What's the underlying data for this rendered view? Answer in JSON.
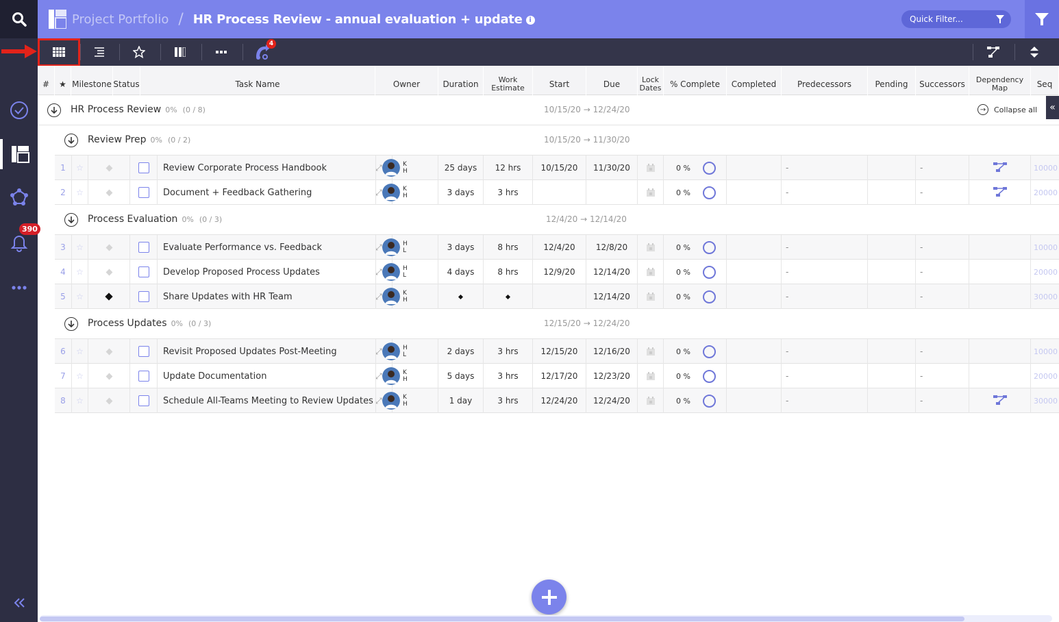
{
  "header": {
    "portfolio": "Project Portfolio",
    "separator": "/",
    "title": "HR Process Review  -  annual evaluation + update",
    "quick_filter_placeholder": "Quick Filter..."
  },
  "rail": {
    "notification_count": "390"
  },
  "toolbar": {
    "automation_badge": "4"
  },
  "columns": {
    "num": "#",
    "star": "★",
    "milestone": "Milestone",
    "status": "Status",
    "task_name": "Task Name",
    "owner": "Owner",
    "duration": "Duration",
    "work_estimate": "Work Estimate",
    "start": "Start",
    "due": "Due",
    "lock_dates": "Lock Dates",
    "pct_complete": "% Complete",
    "completed": "Completed",
    "predecessors": "Predecessors",
    "pending": "Pending",
    "successors": "Successors",
    "dependency_map": "Dependency Map",
    "seq": "Seq"
  },
  "project": {
    "name": "HR Process Review",
    "pct": "0%",
    "count": "(0 / 8)",
    "start": "10/15/20",
    "due": "12/24/20",
    "arrow": "→",
    "collapse_all": "Collapse all"
  },
  "groups": [
    {
      "name": "Review Prep",
      "pct": "0%",
      "count": "(0 / 2)",
      "start": "10/15/20",
      "due": "11/30/20"
    },
    {
      "name": "Process Evaluation",
      "pct": "0%",
      "count": "(0 / 3)",
      "start": "12/4/20",
      "due": "12/14/20"
    },
    {
      "name": "Process Updates",
      "pct": "0%",
      "count": "(0 / 3)",
      "start": "12/15/20",
      "due": "12/24/20"
    }
  ],
  "tasks": [
    {
      "num": "1",
      "name": "Review Corporate Process Handbook",
      "owner_i1": "K",
      "owner_i2": "H",
      "duration": "25 days",
      "work": "12 hrs",
      "start": "10/15/20",
      "due": "11/30/20",
      "pct": "0 %",
      "pred": "-",
      "succ": "-",
      "seq": "10000"
    },
    {
      "num": "2",
      "name": "Document + Feedback Gathering",
      "owner_i1": "K",
      "owner_i2": "H",
      "duration": "3 days",
      "work": "3 hrs",
      "start": "",
      "due": "",
      "pct": "0 %",
      "pred": "-",
      "succ": "-",
      "seq": "20000"
    },
    {
      "num": "3",
      "name": "Evaluate Performance vs. Feedback",
      "owner_i1": "H",
      "owner_i2": "L",
      "duration": "3 days",
      "work": "8 hrs",
      "start": "12/4/20",
      "due": "12/8/20",
      "pct": "0 %",
      "pred": "-",
      "succ": "-",
      "seq": "10000"
    },
    {
      "num": "4",
      "name": "Develop Proposed Process Updates",
      "owner_i1": "H",
      "owner_i2": "L",
      "duration": "4 days",
      "work": "8 hrs",
      "start": "12/9/20",
      "due": "12/14/20",
      "pct": "0 %",
      "pred": "-",
      "succ": "-",
      "seq": "20000"
    },
    {
      "num": "5",
      "name": "Share Updates with HR Team",
      "owner_i1": "K",
      "owner_i2": "H",
      "duration": "",
      "work": "",
      "start": "",
      "due": "12/14/20",
      "pct": "0 %",
      "pred": "-",
      "succ": "-",
      "seq": "30000"
    },
    {
      "num": "6",
      "name": "Revisit Proposed Updates Post-Meeting",
      "owner_i1": "H",
      "owner_i2": "L",
      "duration": "2 days",
      "work": "3 hrs",
      "start": "12/15/20",
      "due": "12/16/20",
      "pct": "0 %",
      "pred": "-",
      "succ": "-",
      "seq": "10000"
    },
    {
      "num": "7",
      "name": "Update Documentation",
      "owner_i1": "K",
      "owner_i2": "H",
      "duration": "5 days",
      "work": "3 hrs",
      "start": "12/17/20",
      "due": "12/23/20",
      "pct": "0 %",
      "pred": "-",
      "succ": "-",
      "seq": "20000"
    },
    {
      "num": "8",
      "name": "Schedule All-Teams Meeting to Review Updates",
      "owner_i1": "K",
      "owner_i2": "H",
      "duration": "1 day",
      "work": "3 hrs",
      "start": "12/24/20",
      "due": "12/24/20",
      "pct": "0 %",
      "pred": "-",
      "succ": "-",
      "seq": "30000"
    }
  ],
  "colors": {
    "accent": "#7b83eb",
    "rail": "#2d2e43",
    "toolbar": "#34354a",
    "badge": "#e2231a"
  }
}
